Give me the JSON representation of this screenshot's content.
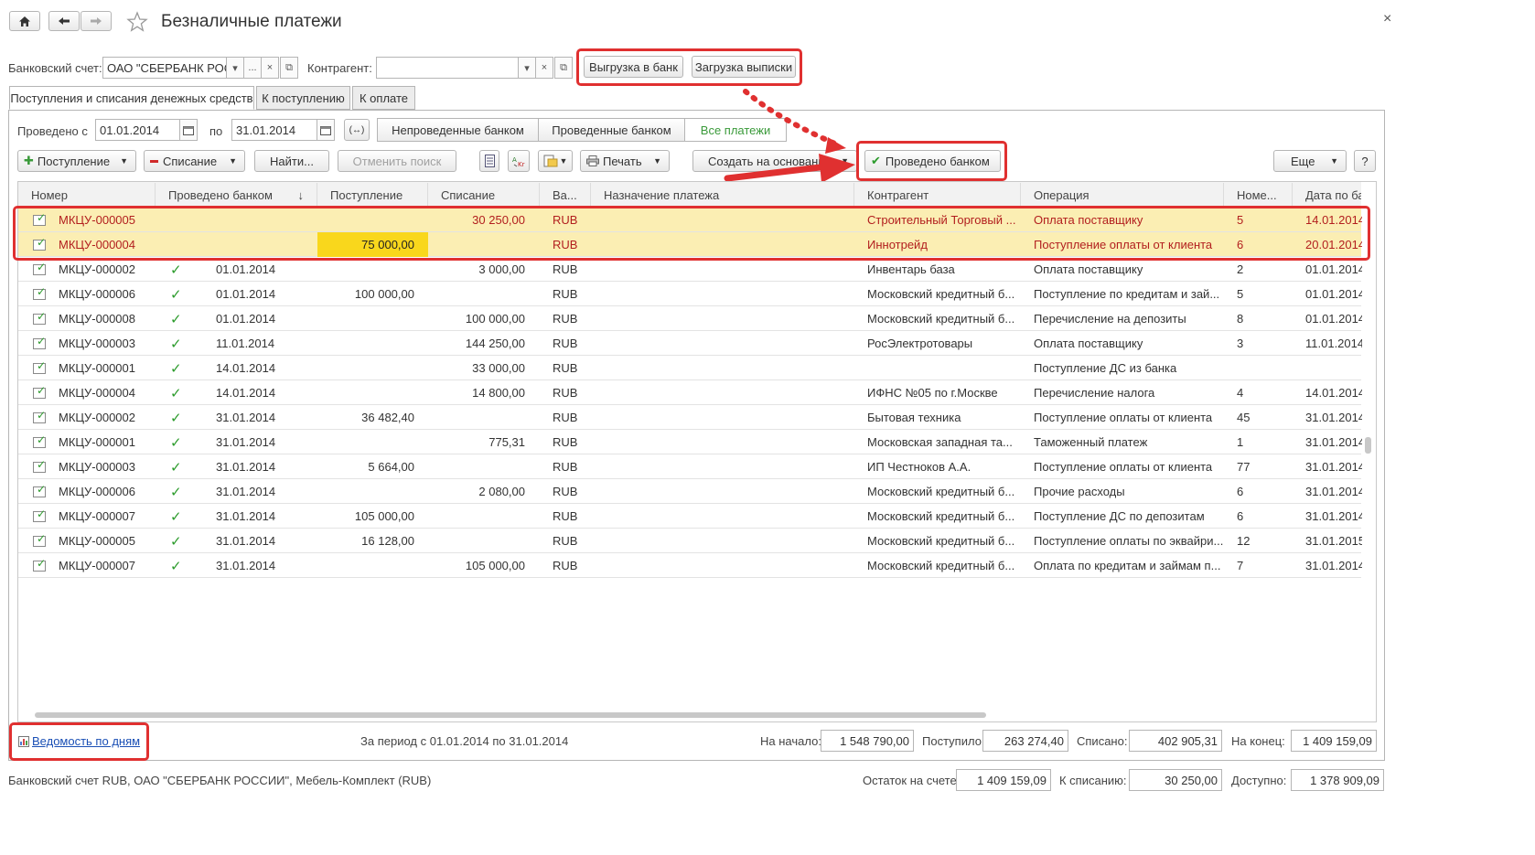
{
  "window": {
    "title": "Безналичные платежи",
    "home_icon": "home-icon",
    "back_icon": "arrow-left-icon",
    "forward_icon": "arrow-right-icon",
    "favorite_icon": "star-icon",
    "close_glyph": "×"
  },
  "filters": {
    "bank_account_label": "Банковский счет:",
    "bank_account_value": "ОАО \"СБЕРБАНК РОС",
    "counterparty_label": "Контрагент:",
    "counterparty_value": "",
    "dots_glyph": "...",
    "clear_glyph": "×",
    "open_glyph": "⧉",
    "dropdown_glyph": "▾",
    "export_button": "Выгрузка в банк",
    "import_button": "Загрузка выписки"
  },
  "tabs": [
    {
      "label": "Поступления и списания денежных средств",
      "active": true
    },
    {
      "label": "К поступлению",
      "active": false
    },
    {
      "label": "К оплате",
      "active": false
    }
  ],
  "period": {
    "from_label": "Проведено с",
    "from_value": "01.01.2014",
    "to_label": "по",
    "to_value": "31.01.2014",
    "period_glyph": "(↔)"
  },
  "status_filter": [
    {
      "label": "Непроведенные банком",
      "active": false
    },
    {
      "label": "Проведенные банком",
      "active": false
    },
    {
      "label": "Все платежи",
      "active": true
    }
  ],
  "toolbar": {
    "receipt_button": "Поступление",
    "writeoff_button": "Списание",
    "find_button": "Найти...",
    "cancel_search_button": "Отменить поиск",
    "print_button": "Печать",
    "create_based_button": "Создать на основании",
    "posted_by_bank_button": "Проведено банком",
    "more_button": "Еще",
    "help_button": "?"
  },
  "table": {
    "columns": [
      "Номер",
      "Проведено банком",
      "Поступление",
      "Списание",
      "Ва...",
      "Назначение платежа",
      "Контрагент",
      "Операция",
      "Номе...",
      "Дата по ба"
    ],
    "sort_glyph": "↓",
    "check_glyph": "✓",
    "rows": [
      {
        "number": "МКЦУ-000005",
        "posted": "",
        "posted_check": false,
        "receipt": "",
        "writeoff": "30 250,00",
        "currency": "RUB",
        "purpose": "",
        "counterparty": "Строительный Торговый ...",
        "operation": "Оплата поставщику",
        "incoming_no": "5",
        "bank_date": "14.01.2014",
        "highlight": true
      },
      {
        "number": "МКЦУ-000004",
        "posted": "",
        "posted_check": false,
        "receipt": "75 000,00",
        "writeoff": "",
        "currency": "RUB",
        "purpose": "",
        "counterparty": "Иннотрейд",
        "operation": "Поступление оплаты от клиента",
        "incoming_no": "6",
        "bank_date": "20.01.2014",
        "highlight": true
      },
      {
        "number": "МКЦУ-000002",
        "posted": "01.01.2014",
        "posted_check": true,
        "receipt": "",
        "writeoff": "3 000,00",
        "currency": "RUB",
        "purpose": "",
        "counterparty": "Инвентарь база",
        "operation": "Оплата поставщику",
        "incoming_no": "2",
        "bank_date": "01.01.2014",
        "highlight": false
      },
      {
        "number": "МКЦУ-000006",
        "posted": "01.01.2014",
        "posted_check": true,
        "receipt": "100 000,00",
        "writeoff": "",
        "currency": "RUB",
        "purpose": "",
        "counterparty": "Московский кредитный б...",
        "operation": "Поступление по кредитам и зай...",
        "incoming_no": "5",
        "bank_date": "01.01.2014",
        "highlight": false
      },
      {
        "number": "МКЦУ-000008",
        "posted": "01.01.2014",
        "posted_check": true,
        "receipt": "",
        "writeoff": "100 000,00",
        "currency": "RUB",
        "purpose": "",
        "counterparty": "Московский кредитный б...",
        "operation": "Перечисление на депозиты",
        "incoming_no": "8",
        "bank_date": "01.01.2014",
        "highlight": false
      },
      {
        "number": "МКЦУ-000003",
        "posted": "11.01.2014",
        "posted_check": true,
        "receipt": "",
        "writeoff": "144 250,00",
        "currency": "RUB",
        "purpose": "",
        "counterparty": "РосЭлектротовары",
        "operation": "Оплата поставщику",
        "incoming_no": "3",
        "bank_date": "11.01.2014",
        "highlight": false
      },
      {
        "number": "МКЦУ-000001",
        "posted": "14.01.2014",
        "posted_check": true,
        "receipt": "",
        "writeoff": "33 000,00",
        "currency": "RUB",
        "purpose": "",
        "counterparty": "",
        "operation": "Поступление ДС из банка",
        "incoming_no": "",
        "bank_date": "",
        "highlight": false
      },
      {
        "number": "МКЦУ-000004",
        "posted": "14.01.2014",
        "posted_check": true,
        "receipt": "",
        "writeoff": "14 800,00",
        "currency": "RUB",
        "purpose": "",
        "counterparty": "ИФНС №05 по г.Москве",
        "operation": "Перечисление налога",
        "incoming_no": "4",
        "bank_date": "14.01.2014",
        "highlight": false
      },
      {
        "number": "МКЦУ-000002",
        "posted": "31.01.2014",
        "posted_check": true,
        "receipt": "36 482,40",
        "writeoff": "",
        "currency": "RUB",
        "purpose": "",
        "counterparty": "Бытовая техника",
        "operation": "Поступление оплаты от клиента",
        "incoming_no": "45",
        "bank_date": "31.01.2014",
        "highlight": false
      },
      {
        "number": "МКЦУ-000001",
        "posted": "31.01.2014",
        "posted_check": true,
        "receipt": "",
        "writeoff": "775,31",
        "currency": "RUB",
        "purpose": "",
        "counterparty": "Московская западная та...",
        "operation": "Таможенный платеж",
        "incoming_no": "1",
        "bank_date": "31.01.2014",
        "highlight": false
      },
      {
        "number": "МКЦУ-000003",
        "posted": "31.01.2014",
        "posted_check": true,
        "receipt": "5 664,00",
        "writeoff": "",
        "currency": "RUB",
        "purpose": "",
        "counterparty": "ИП Честноков А.А.",
        "operation": "Поступление оплаты от клиента",
        "incoming_no": "77",
        "bank_date": "31.01.2014",
        "highlight": false
      },
      {
        "number": "МКЦУ-000006",
        "posted": "31.01.2014",
        "posted_check": true,
        "receipt": "",
        "writeoff": "2 080,00",
        "currency": "RUB",
        "purpose": "",
        "counterparty": "Московский кредитный б...",
        "operation": "Прочие расходы",
        "incoming_no": "6",
        "bank_date": "31.01.2014",
        "highlight": false
      },
      {
        "number": "МКЦУ-000007",
        "posted": "31.01.2014",
        "posted_check": true,
        "receipt": "105 000,00",
        "writeoff": "",
        "currency": "RUB",
        "purpose": "",
        "counterparty": "Московский кредитный б...",
        "operation": "Поступление ДС по депозитам",
        "incoming_no": "6",
        "bank_date": "31.01.2014",
        "highlight": false
      },
      {
        "number": "МКЦУ-000005",
        "posted": "31.01.2014",
        "posted_check": true,
        "receipt": "16 128,00",
        "writeoff": "",
        "currency": "RUB",
        "purpose": "",
        "counterparty": "Московский кредитный б...",
        "operation": "Поступление оплаты по эквайри...",
        "incoming_no": "12",
        "bank_date": "31.01.2015",
        "highlight": false
      },
      {
        "number": "МКЦУ-000007",
        "posted": "31.01.2014",
        "posted_check": true,
        "receipt": "",
        "writeoff": "105 000,00",
        "currency": "RUB",
        "purpose": "",
        "counterparty": "Московский кредитный б...",
        "operation": "Оплата по кредитам и займам п...",
        "incoming_no": "7",
        "bank_date": "31.01.2014",
        "highlight": false
      }
    ]
  },
  "footer": {
    "daily_report_link": "Ведомость по дням",
    "period_text": "За период с 01.01.2014 по 31.01.2014",
    "start_label": "На начало:",
    "start_value": "1 548 790,00",
    "received_label": "Поступило:",
    "received_value": "263 274,40",
    "written_off_label": "Списано:",
    "written_off_value": "402 905,31",
    "end_label": "На конец:",
    "end_value": "1 409 159,09"
  },
  "status_bar": {
    "account_info": "Банковский счет RUB, ОАО \"СБЕРБАНК РОССИИ\", Мебель-Комплект (RUB)",
    "balance_label": "Остаток на счете:",
    "balance_value": "1 409 159,09",
    "to_write_off_label": "К списанию:",
    "to_write_off_value": "30 250,00",
    "available_label": "Доступно:",
    "available_value": "1 378 909,09"
  },
  "colors": {
    "highlight_row": "#fbeeb3",
    "highlight_text": "#b21e1e",
    "selected_cell": "#f9d71c",
    "annotation_red": "#e03030",
    "check_green": "#2c9b2c"
  }
}
